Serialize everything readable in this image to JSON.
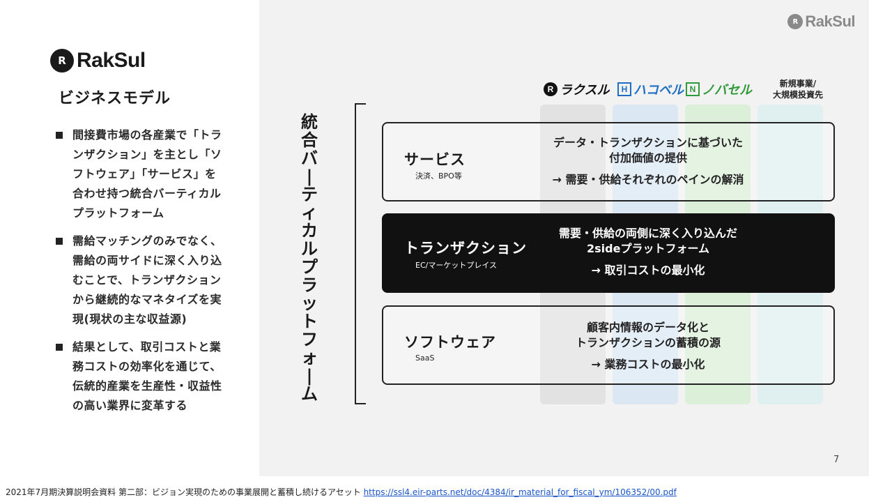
{
  "left": {
    "logo_text": "RakSul",
    "title": "ビジネスモデル",
    "bullets": [
      {
        "lines": [
          "間接費市場の各産業で「トラ",
          "ンザクション」を主とし「ソ",
          "フトウェア」「サービス」を",
          "合わせ持つ統合バーティカル",
          "プラットフォーム"
        ]
      },
      {
        "lines": [
          "需給マッチングのみでなく、",
          "需給の両サイドに深く入り込",
          "むことで、トランザクション",
          "から継続的なマネタイズを実",
          "現(現状の主な収益源)"
        ]
      },
      {
        "lines": [
          "結果として、取引コストと業",
          "務コストの効率化を通じて、",
          "伝統的産業を生産性・収益性",
          "の高い業界に変革する"
        ]
      }
    ]
  },
  "slide": {
    "logo_text": "RakSul",
    "vertical_title": [
      "統",
      "合",
      "バ",
      "ー",
      "テ",
      "ィ",
      "カ",
      "ル",
      "プ",
      "ラ",
      "ッ",
      "ト",
      "フ",
      "ォ",
      "ー",
      "ム"
    ],
    "brands": [
      {
        "name": "ラクスル",
        "color": "#111111"
      },
      {
        "name": "ハコベル",
        "color": "#1e6fc2"
      },
      {
        "name": "ノバセル",
        "color": "#2e9a3a"
      }
    ],
    "brand_new": [
      "新規事業/",
      "大規模投資先"
    ],
    "column_colors": [
      "#e2e2e2",
      "#dbe8f4",
      "#dcefd9",
      "#e0f0f0"
    ],
    "rows": [
      {
        "title": "サービス",
        "sub": "決済、BPO等",
        "desc": [
          "データ・トランザクションに基づいた",
          "付加価値の提供"
        ],
        "arrow": "→ 需要・供給それぞれのペインの解消",
        "dark": false
      },
      {
        "title": "トランザクション",
        "sub": "EC/マーケットプレイス",
        "desc": [
          "需要・供給の両側に深く入り込んだ",
          "2sideプラットフォーム"
        ],
        "arrow": "→ 取引コストの最小化",
        "dark": true
      },
      {
        "title": "ソフトウェア",
        "sub": "SaaS",
        "desc": [
          "顧客内情報のデータ化と",
          "トランザクションの蓄積の源"
        ],
        "arrow": "→ 業務コストの最小化",
        "dark": false
      }
    ],
    "page_number": "7"
  },
  "footer": {
    "text": "2021年7月期決算説明会資料 第二部：ビジョン実現のための事業展開と蓄積し続けるアセット ",
    "link": "https://ssl4.eir-parts.net/doc/4384/ir_material_for_fiscal_ym/106352/00.pdf"
  }
}
